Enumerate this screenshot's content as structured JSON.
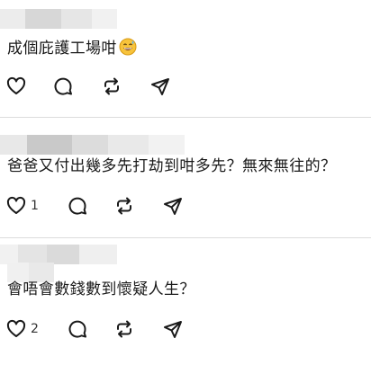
{
  "comments": [
    {
      "author": "",
      "text": "成個庇護工場咁",
      "emoji": "grinning-sweat-emoji",
      "like_count": "",
      "actions": [
        "heart-icon",
        "comment-icon",
        "repost-icon",
        "share-icon"
      ]
    },
    {
      "author": "",
      "text": "爸爸又付出幾多先打劫到咁多先？無來無往的？",
      "like_count": "1",
      "actions": [
        "heart-icon",
        "comment-icon",
        "repost-icon",
        "share-icon"
      ]
    },
    {
      "author": "",
      "text": "會唔會數錢數到懷疑人生？",
      "like_count": "2",
      "actions": [
        "heart-icon",
        "comment-icon",
        "repost-icon",
        "share-icon"
      ]
    }
  ]
}
